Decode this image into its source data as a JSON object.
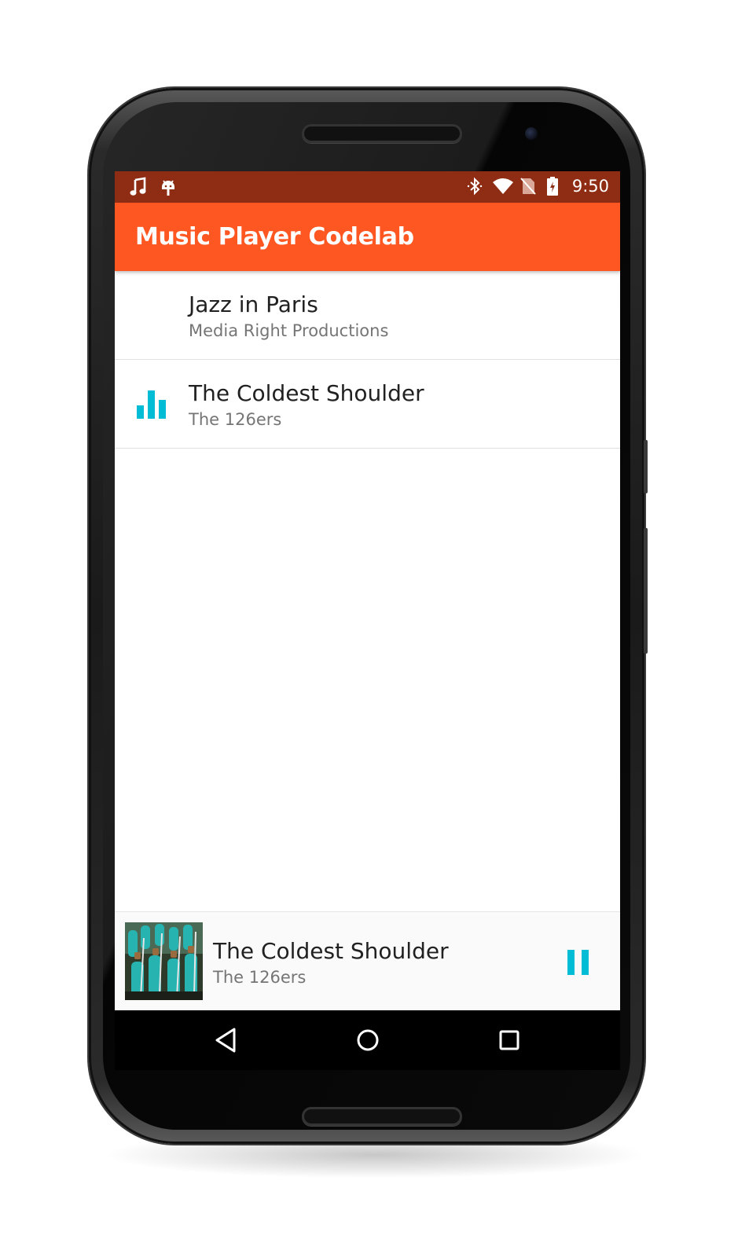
{
  "status_bar": {
    "time": "9:50",
    "left_icons": [
      "music-note-icon",
      "android-debug-icon"
    ],
    "right_icons": [
      "bluetooth-icon",
      "wifi-icon",
      "no-sim-icon",
      "battery-charging-icon"
    ]
  },
  "app_bar": {
    "title": "Music Player Codelab",
    "color": "#ff5722"
  },
  "tracks": [
    {
      "title": "Jazz in Paris",
      "artist": "Media Right Productions",
      "playing": false
    },
    {
      "title": "The Coldest Shoulder",
      "artist": "The 126ers",
      "playing": true,
      "indicator_icon": "equalizer-icon"
    }
  ],
  "now_playing": {
    "title": "The Coldest Shoulder",
    "artist": "The 126ers",
    "control_icon": "pause-icon",
    "accent_color": "#00bcd4"
  },
  "nav_bar": {
    "buttons": [
      "back-icon",
      "home-icon",
      "recents-icon"
    ]
  }
}
